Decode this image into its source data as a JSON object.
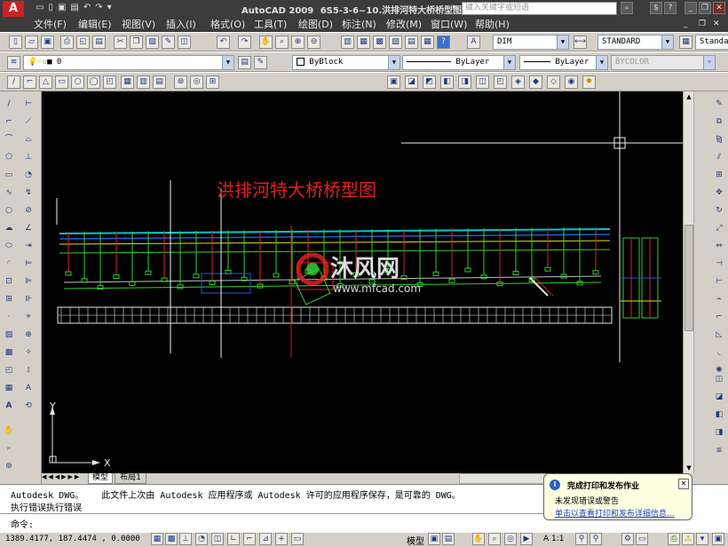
{
  "window": {
    "title_app": "AutoCAD 2009",
    "title_file": "6S5-3-6~10.洪排河特大桥桥型图",
    "search_placeholder": "键入关键字或短语"
  },
  "menu": [
    "文件(F)",
    "编辑(E)",
    "视图(V)",
    "插入(I)",
    "格式(O)",
    "工具(T)",
    "绘图(D)",
    "标注(N)",
    "修改(M)",
    "窗口(W)",
    "帮助(H)"
  ],
  "toolbar_styles": {
    "dimstyle": "DIM",
    "textstyle": "STANDARD",
    "tablestyle": "Standar"
  },
  "layers": {
    "current_layer": "0",
    "color": "ByBlock",
    "linetype": "ByLayer",
    "lineweight": "ByLayer",
    "plotstyle": "BYCOLOR"
  },
  "drawing": {
    "title": "洪排河特大桥桥型图",
    "watermark": "沐风网",
    "watermark_url": "www.mfcad.com",
    "axis_x": "X",
    "axis_y": "Y"
  },
  "tabs": [
    "模型",
    "布局1"
  ],
  "command": {
    "line1_a": "Autodesk DWG。",
    "line1_b": "此文件上次由 Autodesk 应用程序或 Autodesk 许可的应用程序保存，是可靠的 DWG。",
    "line2": "执行错误执行错误",
    "prompt": "命令:"
  },
  "balloon": {
    "title": "完成打印和发布作业",
    "line1": "未发现错误或警告",
    "link": "单击以查看打印和发布详细信息..."
  },
  "status": {
    "coords": "1389.4177, 187.4474 , 0.0000",
    "space": "模型",
    "scale": "A 1:1"
  }
}
